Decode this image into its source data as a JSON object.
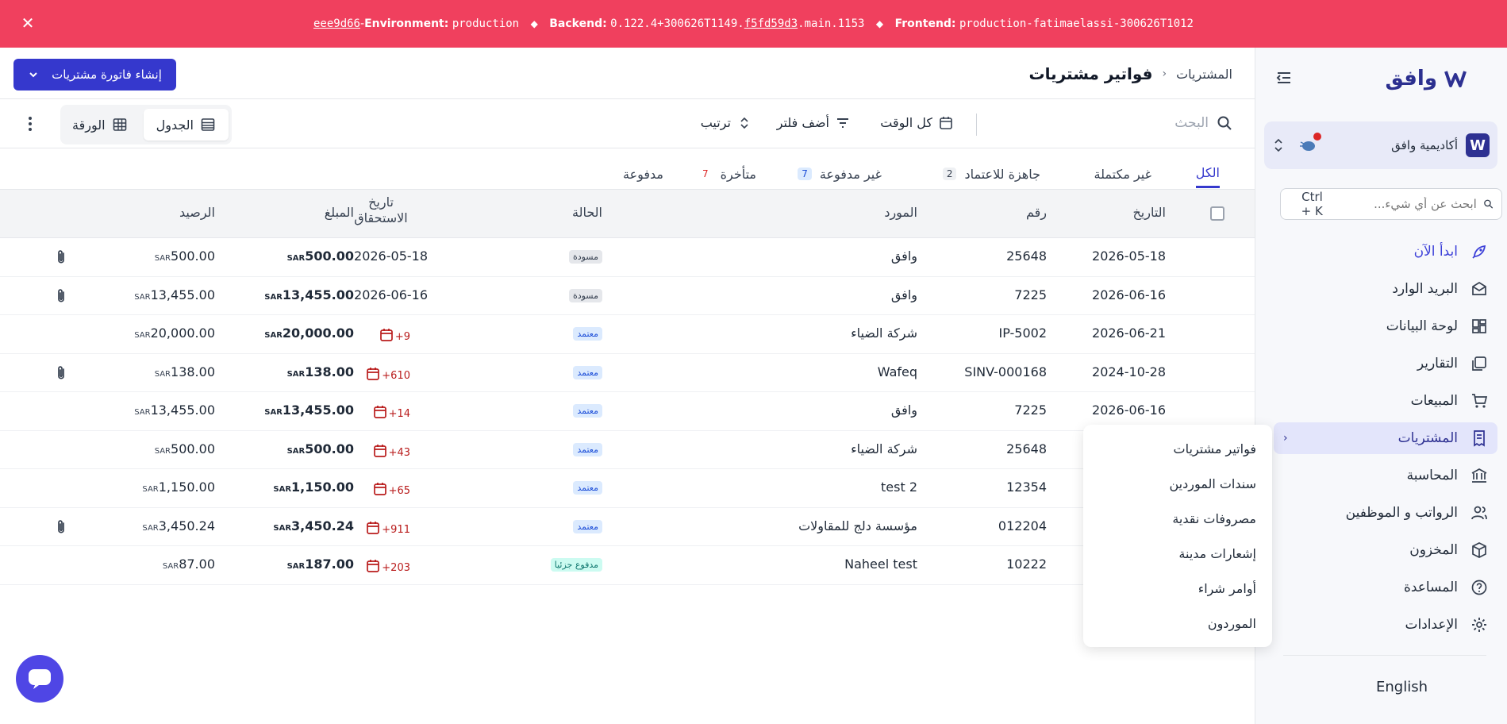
{
  "banner": {
    "hash": "eee9d66",
    "env_label": "Environment:",
    "env_value": "production",
    "backend_label": "Backend:",
    "backend_prefix": "0.122.4+300626T1149.",
    "backend_hash": "f5fd59d3",
    "backend_suffix": ".main.1153",
    "frontend_label": "Frontend:",
    "frontend_value": "production-fatimaelassi-300626T1012",
    "close_icon": "close-icon"
  },
  "sidebar": {
    "brand": "وافق",
    "org_name": "أكاديمية وافق",
    "org_logo_letter": "W",
    "search_placeholder": "ابحث عن أي شيء...",
    "search_hint": "Ctrl + K",
    "items": [
      {
        "label": "ابدأ الآن",
        "icon": "rocket-icon"
      },
      {
        "label": "البريد الوارد",
        "icon": "inbox-icon"
      },
      {
        "label": "لوحة البيانات",
        "icon": "dashboard-icon"
      },
      {
        "label": "التقارير",
        "icon": "reports-icon"
      },
      {
        "label": "المبيعات",
        "icon": "cart-icon"
      },
      {
        "label": "المشتريات",
        "icon": "receipt-icon"
      },
      {
        "label": "المحاسبة",
        "icon": "bank-icon"
      },
      {
        "label": "الرواتب و الموظفين",
        "icon": "users-icon"
      },
      {
        "label": "المخزون",
        "icon": "box-icon"
      },
      {
        "label": "المساعدة",
        "icon": "help-icon"
      },
      {
        "label": "الإعدادات",
        "icon": "gear-icon"
      }
    ],
    "language": "English"
  },
  "header": {
    "breadcrumb_parent": "المشتريات",
    "title": "فواتير مشتريات",
    "create_button": "إنشاء فاتورة مشتريات"
  },
  "toolbar": {
    "search_placeholder": "البحث",
    "period": "كل الوقت",
    "filter": "أضف فلتر",
    "sort": "ترتيب",
    "view_table": "الجدول",
    "view_sheet": "الورقة"
  },
  "tabs": [
    {
      "label": "الكل",
      "badge": ""
    },
    {
      "label": "غير مكتملة",
      "badge": ""
    },
    {
      "label": "جاهزة للاعتماد",
      "badge": "2"
    },
    {
      "label": "غير مدفوعة",
      "badge": "7"
    },
    {
      "label": "متأخرة",
      "badge": "7"
    },
    {
      "label": "مدفوعة",
      "badge": ""
    }
  ],
  "table": {
    "columns": {
      "date": "التاريخ",
      "number": "رقم",
      "supplier": "المورد",
      "status": "الحالة",
      "due_date": "تاريخ الاستحقاق",
      "amount": "المبلغ",
      "balance": "الرصيد"
    },
    "currency": "SAR",
    "rows": [
      {
        "date": "2026-05-18",
        "number": "25648",
        "supplier": "وافق",
        "status": "مسودة",
        "status_type": "draft",
        "due": "2026-05-18",
        "overdue": "",
        "amount": "500.00",
        "balance": "500.00",
        "attachment": true
      },
      {
        "date": "2026-06-16",
        "number": "7225",
        "supplier": "وافق",
        "status": "مسودة",
        "status_type": "draft",
        "due": "2026-06-16",
        "overdue": "",
        "amount": "13,455.00",
        "balance": "13,455.00",
        "attachment": true
      },
      {
        "date": "2026-06-21",
        "number": "IP-5002",
        "supplier": "شركة الضياء",
        "status": "معتمد",
        "status_type": "approved",
        "due": "",
        "overdue": "+9",
        "amount": "20,000.00",
        "balance": "20,000.00",
        "attachment": false
      },
      {
        "date": "2024-10-28",
        "number": "SINV-000168",
        "supplier": "Wafeq",
        "status": "معتمد",
        "status_type": "approved",
        "due": "",
        "overdue": "+610",
        "amount": "138.00",
        "balance": "138.00",
        "attachment": true
      },
      {
        "date": "2026-06-16",
        "number": "7225",
        "supplier": "وافق",
        "status": "معتمد",
        "status_type": "approved",
        "due": "",
        "overdue": "+14",
        "amount": "13,455.00",
        "balance": "13,455.00",
        "attachment": false
      },
      {
        "date": "",
        "number": "25648",
        "supplier": "شركة الضياء",
        "status": "معتمد",
        "status_type": "approved",
        "due": "",
        "overdue": "+43",
        "amount": "500.00",
        "balance": "500.00",
        "attachment": false
      },
      {
        "date": "",
        "number": "12354",
        "supplier": "test 2",
        "status": "معتمد",
        "status_type": "approved",
        "due": "",
        "overdue": "+65",
        "amount": "1,150.00",
        "balance": "1,150.00",
        "attachment": false
      },
      {
        "date": "",
        "number": "012204",
        "supplier": "مؤسسة دلج للمقاولات",
        "status": "معتمد",
        "status_type": "approved",
        "due": "",
        "overdue": "+911",
        "amount": "3,450.24",
        "balance": "3,450.24",
        "attachment": true
      },
      {
        "date": "",
        "number": "10222",
        "supplier": "Naheel test",
        "status": "مدفوع جزئيا",
        "status_type": "partial",
        "due": "",
        "overdue": "+203",
        "amount": "187.00",
        "balance": "87.00",
        "attachment": false
      }
    ]
  },
  "submenu": [
    "فواتير مشتريات",
    "سندات الموردين",
    "مصروفات نقدية",
    "إشعارات مدينة",
    "أوامر شراء",
    "الموردون"
  ],
  "colors": {
    "banner": "#f0405e",
    "accent": "#3538cd",
    "overdue": "#b91c1c"
  }
}
